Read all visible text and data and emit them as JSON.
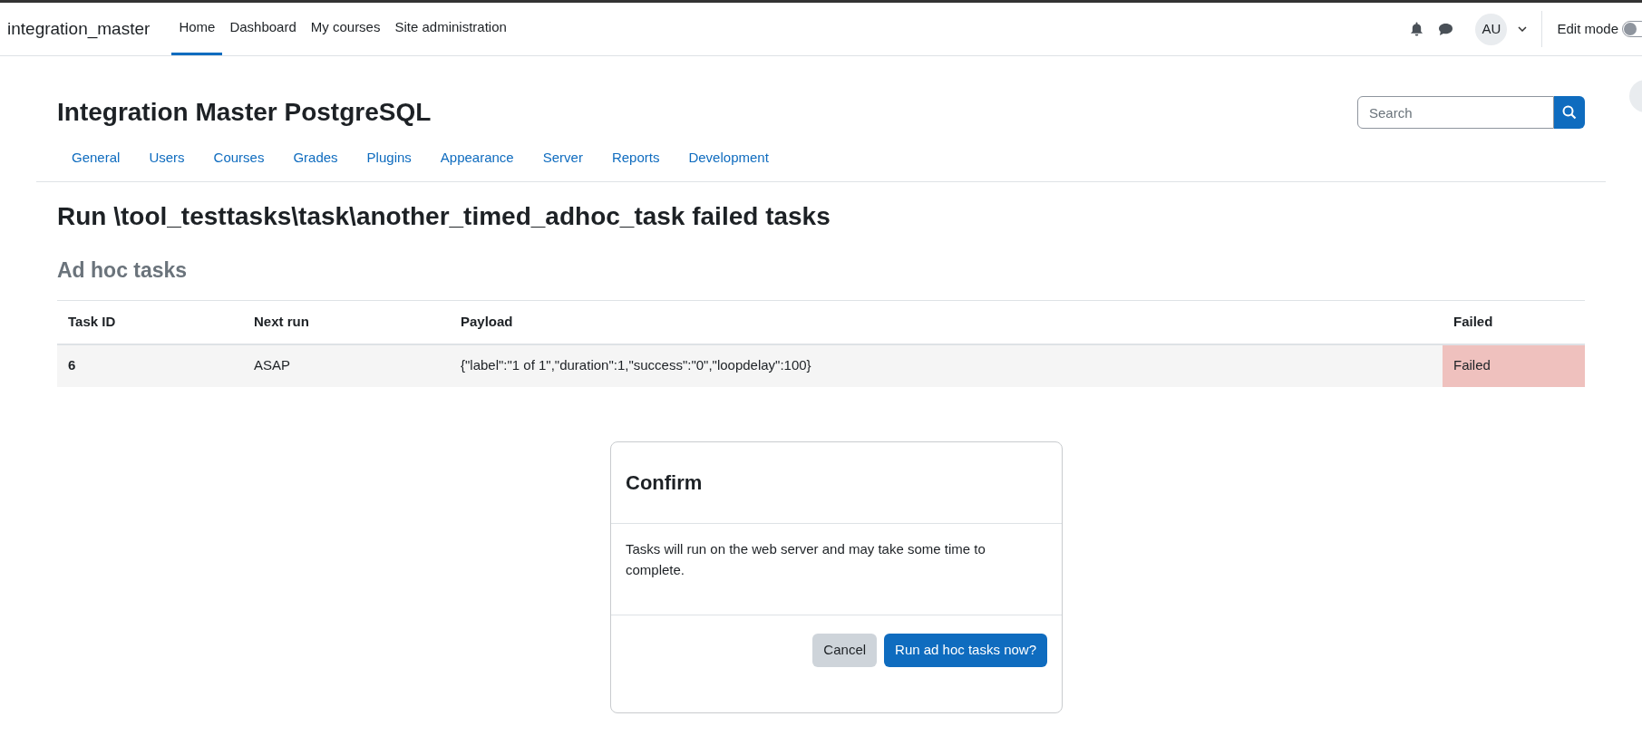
{
  "navbar": {
    "brand": "integration_master",
    "items": [
      {
        "label": "Home",
        "selected": true
      },
      {
        "label": "Dashboard",
        "selected": false
      },
      {
        "label": "My courses",
        "selected": false
      },
      {
        "label": "Site administration",
        "selected": false
      }
    ],
    "avatar": "AU",
    "edit_mode": {
      "label": "Edit mode",
      "on": false
    }
  },
  "header": {
    "title": "Integration Master PostgreSQL",
    "search": {
      "placeholder": "Search"
    }
  },
  "admin_tabs": [
    "General",
    "Users",
    "Courses",
    "Grades",
    "Plugins",
    "Appearance",
    "Server",
    "Reports",
    "Development"
  ],
  "page_title": "Run \\tool_testtasks\\task\\another_timed_adhoc_task failed tasks",
  "section_title": "Ad hoc tasks",
  "table": {
    "columns": [
      "Task ID",
      "Next run",
      "Payload",
      "Failed"
    ],
    "rows": [
      {
        "task_id": "6",
        "next_run": "ASAP",
        "payload": "{\"label\":\"1 of 1\",\"duration\":1,\"success\":\"0\",\"loopdelay\":100}",
        "failed": "Failed",
        "is_failed": true
      }
    ]
  },
  "dialog": {
    "title": "Confirm",
    "body": "Tasks will run on the web server and may take some time to complete.",
    "buttons": [
      {
        "label": "Cancel",
        "kind": "secondary"
      },
      {
        "label": "Run ad hoc tasks now?",
        "kind": "primary"
      }
    ]
  }
}
